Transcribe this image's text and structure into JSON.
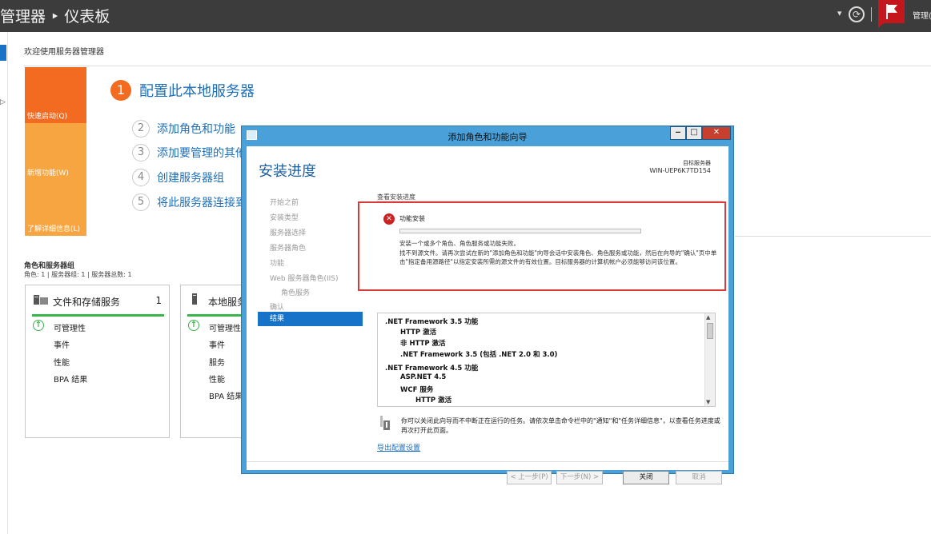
{
  "header": {
    "title": "管理器 ‣ 仪表板",
    "user_label": "管理("
  },
  "welcome": {
    "title": "欢迎使用服务器管理器"
  },
  "quick_tiles": [
    "快速启动(Q)",
    "新增功能(W)",
    "了解详细信息(L)"
  ],
  "steps": [
    {
      "num": "1",
      "label": "配置此本地服务器"
    },
    {
      "num": "2",
      "label": "添加角色和功能"
    },
    {
      "num": "3",
      "label": "添加要管理的其他"
    },
    {
      "num": "4",
      "label": "创建服务器组"
    },
    {
      "num": "5",
      "label": "将此服务器连接到"
    }
  ],
  "roles": {
    "title": "角色和服务器组",
    "summary": "角色: 1 | 服务器组: 1 | 服务器总数: 1",
    "cards": [
      {
        "title": "文件和存储服务",
        "count": "1",
        "rows": [
          "可管理性",
          "事件",
          "性能",
          "BPA 结果"
        ]
      },
      {
        "title": "本地服务",
        "count": "",
        "rows": [
          "可管理性",
          "事件",
          "服务",
          "性能",
          "BPA 结果"
        ]
      }
    ]
  },
  "dialog": {
    "window_title": "添加角色和功能向导",
    "heading": "安装进度",
    "target_label": "目标服务器",
    "target_server": "WIN-UEP6K7TD154",
    "nav": [
      "开始之前",
      "安装类型",
      "服务器选择",
      "服务器角色",
      "功能",
      "Web 服务器角色(IIS)",
      "角色服务",
      "确认",
      "结果"
    ],
    "view_progress": "查看安装进度",
    "error_title": "功能安装",
    "error_summary": "安装一个或多个角色、角色服务或功能失败。",
    "error_detail": "找不到源文件。请再次尝试在新的\"添加角色和功能\"向导会话中安装角色、角色服务或功能，然后在向导的\"确认\"页中单击\"指定备用源路径\"以指定安装所需的源文件的有效位置。目标服务器的计算机帐户必须能够访问该位置。",
    "features": [
      {
        "text": ".NET Framework 3.5 功能",
        "level": 0
      },
      {
        "text": "HTTP 激活",
        "level": 1
      },
      {
        "text": "非 HTTP 激活",
        "level": 1
      },
      {
        "text": ".NET Framework 3.5 (包括 .NET 2.0 和 3.0)",
        "level": 1
      },
      {
        "text": ".NET Framework 4.5 功能",
        "level": 0
      },
      {
        "text": "ASP.NET 4.5",
        "level": 1
      },
      {
        "text": "WCF 服务",
        "level": 1
      },
      {
        "text": "HTTP 激活",
        "level": 2
      }
    ],
    "note": "你可以关闭此向导而不中断正在运行的任务。请依次单击命令栏中的\"通知\"和\"任务详细信息\"，以查看任务进度或再次打开此页面。",
    "export_link": "导出配置设置",
    "buttons": {
      "prev": "< 上一步(P)",
      "next": "下一步(N) >",
      "close": "关闭",
      "cancel": "取消"
    }
  },
  "colors": {
    "accent": "#1673c7",
    "tile_primary": "#f26b21",
    "tile_secondary": "#f7a541",
    "error": "#d93a3a",
    "ok": "#39b54a"
  }
}
